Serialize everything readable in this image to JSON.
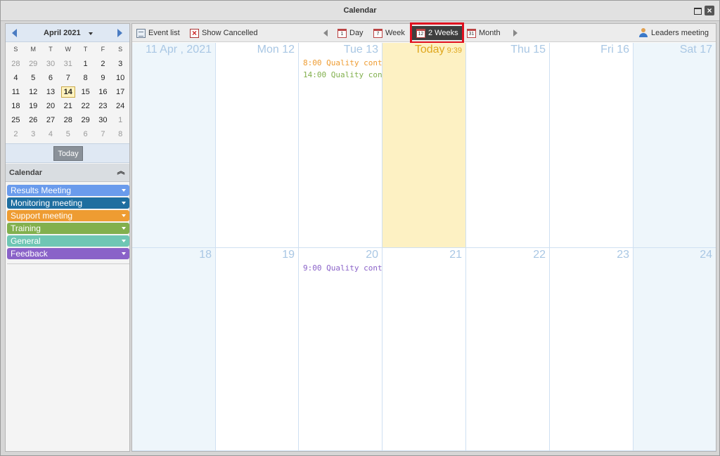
{
  "window": {
    "title": "Calendar"
  },
  "mini_calendar": {
    "month_label": "April 2021",
    "weekday_headers": [
      "S",
      "M",
      "T",
      "W",
      "T",
      "F",
      "S"
    ],
    "weeks": [
      [
        "28",
        "29",
        "30",
        "31",
        "1",
        "2",
        "3"
      ],
      [
        "4",
        "5",
        "6",
        "7",
        "8",
        "9",
        "10"
      ],
      [
        "11",
        "12",
        "13",
        "14",
        "15",
        "16",
        "17"
      ],
      [
        "18",
        "19",
        "20",
        "21",
        "22",
        "23",
        "24"
      ],
      [
        "25",
        "26",
        "27",
        "28",
        "29",
        "30",
        "1"
      ],
      [
        "2",
        "3",
        "4",
        "5",
        "6",
        "7",
        "8"
      ]
    ],
    "selected_day": "14",
    "today_button": "Today"
  },
  "calendars_panel": {
    "title": "Calendar",
    "items": [
      {
        "label": "Results Meeting",
        "color": "#6a9bec"
      },
      {
        "label": "Monitoring meeting",
        "color": "#1e6ea0"
      },
      {
        "label": "Support meeting",
        "color": "#ee9c32"
      },
      {
        "label": "Training",
        "color": "#82b04e"
      },
      {
        "label": "General",
        "color": "#6fc6b4"
      },
      {
        "label": "Feedback",
        "color": "#8a62c8"
      }
    ]
  },
  "toolbar": {
    "event_list": "Event list",
    "show_cancelled": "Show Cancelled",
    "views": {
      "day": "Day",
      "day_icon": "1",
      "week": "Week",
      "week_icon": "7",
      "two_weeks": "2 Weeks",
      "two_weeks_icon": "12",
      "month": "Month",
      "month_icon": "31"
    },
    "active_view": "2 Weeks",
    "calendar_selector": "Leaders meeting"
  },
  "view": {
    "days": [
      {
        "label": "11 Apr , 2021",
        "weekend": true,
        "events": []
      },
      {
        "label": "Mon 12",
        "weekend": false,
        "events": []
      },
      {
        "label": "Tue 13",
        "weekend": false,
        "events": [
          {
            "text": "8:00 Quality cont…",
            "color": "#ee9c32"
          },
          {
            "text": "14:00 Quality con…",
            "color": "#82b04e"
          }
        ]
      },
      {
        "label": "Today",
        "time": "9:39",
        "today": true,
        "weekend": false,
        "events": []
      },
      {
        "label": "Thu 15",
        "weekend": false,
        "events": []
      },
      {
        "label": "Fri 16",
        "weekend": false,
        "events": []
      },
      {
        "label": "Sat 17",
        "weekend": true,
        "events": []
      },
      {
        "label": "18",
        "weekend": true,
        "events": []
      },
      {
        "label": "19",
        "weekend": false,
        "events": []
      },
      {
        "label": "20",
        "weekend": false,
        "events": [
          {
            "text": "9:00 Quality cont…",
            "color": "#8a62c8"
          }
        ]
      },
      {
        "label": "21",
        "weekend": false,
        "events": []
      },
      {
        "label": "22",
        "weekend": false,
        "events": []
      },
      {
        "label": "23",
        "weekend": false,
        "events": []
      },
      {
        "label": "24",
        "weekend": true,
        "events": []
      }
    ]
  }
}
